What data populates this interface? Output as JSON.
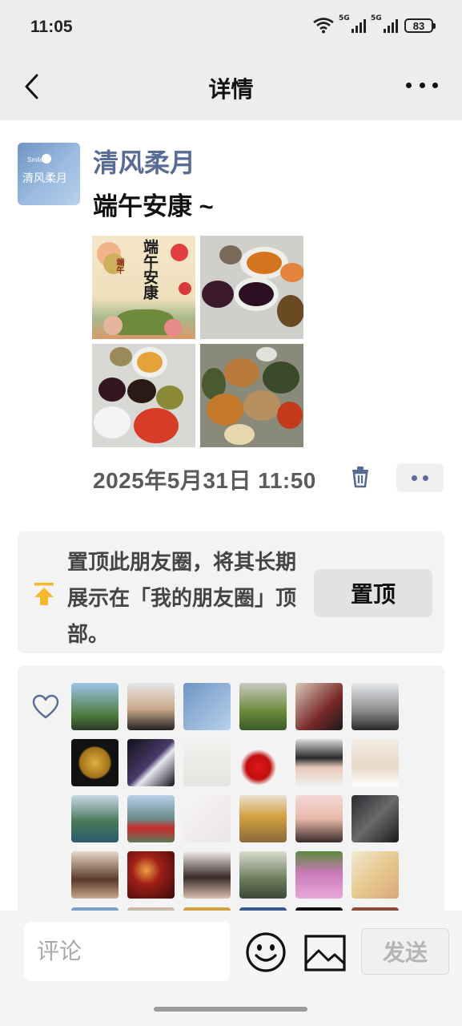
{
  "status_bar": {
    "time": "11:05",
    "network_1": "5G",
    "network_2": "5G",
    "battery": "83"
  },
  "header": {
    "title": "详情"
  },
  "post": {
    "username": "清风柔月",
    "text": "端午安康 ~",
    "avatar_text": "清风柔月",
    "avatar_small_text": "Smile",
    "photo1_title": "端午安康",
    "photo1_badge": "端午",
    "timestamp": "2025年5月31日 11:50"
  },
  "pin_card": {
    "description": "置顶此朋友圈，将其长期展示在「我的朋友圈」顶部。",
    "button_label": "置顶"
  },
  "likes": {
    "avatars": [
      {
        "icon": "person-mountain"
      },
      {
        "icon": "man-microphone"
      },
      {
        "icon": "sky-calligraphy"
      },
      {
        "icon": "garden-flowers"
      },
      {
        "icon": "man-car"
      },
      {
        "icon": "motorcycle"
      },
      {
        "icon": "gold-coin"
      },
      {
        "icon": "dancer-dark"
      },
      {
        "icon": "praying-hands"
      },
      {
        "icon": "cherries"
      },
      {
        "icon": "woman-sunglasses"
      },
      {
        "icon": "bride"
      },
      {
        "icon": "waterfall"
      },
      {
        "icon": "lake-red-figure"
      },
      {
        "icon": "flower-sketch"
      },
      {
        "icon": "autumn-tree"
      },
      {
        "icon": "girl-cartoon"
      },
      {
        "icon": "dark-interior"
      },
      {
        "icon": "woman-portrait"
      },
      {
        "icon": "star-red"
      },
      {
        "icon": "woman-dark"
      },
      {
        "icon": "bird-statue"
      },
      {
        "icon": "pink-flowers"
      },
      {
        "icon": "painting-woman"
      }
    ]
  },
  "bottom_bar": {
    "comment_placeholder": "评论",
    "send_label": "发送"
  },
  "colors": {
    "username": "#576b95",
    "background": "#ededed",
    "pin_icon": "#f5b82e"
  }
}
